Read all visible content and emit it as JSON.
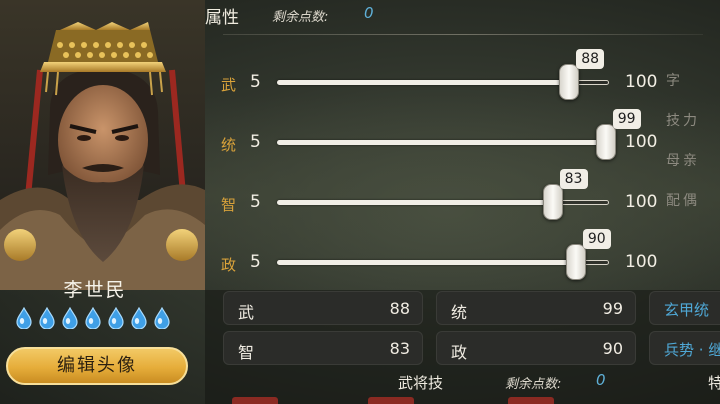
{
  "attributes": {
    "title": "属性",
    "remaining_label": "剩余点数:",
    "remaining_value": "0",
    "rows": [
      {
        "label": "武",
        "base": "5",
        "value": 88,
        "value_text": "88",
        "max": "100"
      },
      {
        "label": "统",
        "base": "5",
        "value": 99,
        "value_text": "99",
        "max": "100"
      },
      {
        "label": "智",
        "base": "5",
        "value": 83,
        "value_text": "83",
        "max": "100"
      },
      {
        "label": "政",
        "base": "5",
        "value": 90,
        "value_text": "90",
        "max": "100"
      }
    ]
  },
  "side_tags": [
    "字",
    "技力",
    "母亲",
    "配偶"
  ],
  "hero": {
    "name": "李世民",
    "star_count": 7,
    "edit_button": "编辑头像"
  },
  "stats": {
    "items": [
      {
        "label": "武",
        "value": "88"
      },
      {
        "label": "统",
        "value": "99"
      },
      {
        "label": "智",
        "value": "83"
      },
      {
        "label": "政",
        "value": "90"
      }
    ],
    "tags": [
      "玄甲统",
      "兵势 · 继"
    ]
  },
  "skills": {
    "title": "武将技",
    "remaining_label": "剩余点数:",
    "remaining_value": "0",
    "special_label": "特"
  },
  "colors": {
    "accent_gold": "#d9a23a",
    "points_blue": "#5fb0d8",
    "button_gold": "#e6ad3a"
  }
}
